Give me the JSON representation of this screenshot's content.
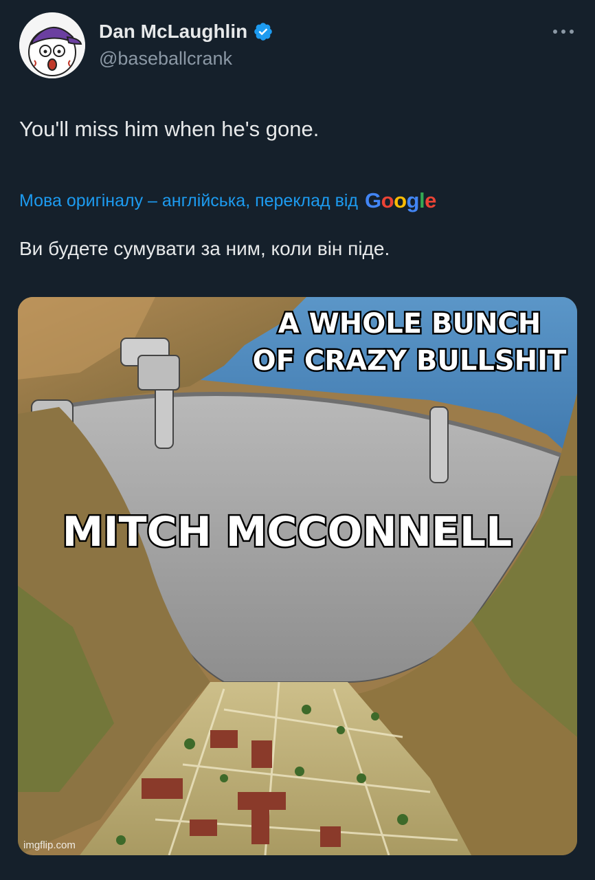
{
  "author": {
    "name": "Dan McLaughlin",
    "handle": "@baseballcrank",
    "verified": true,
    "avatar_icon": "baseball-cartoon-avatar"
  },
  "tweet": {
    "text": "You'll miss him when he's gone.",
    "translation_notice": "Мова оригіналу – англійська, переклад від",
    "translation_provider": "Google",
    "translated_text": "Ви будете сумувати за ним, коли він піде."
  },
  "media": {
    "top_caption_line1": "A WHOLE BUNCH",
    "top_caption_line2": "OF CRAZY BULLSHIT",
    "center_caption": "MITCH MCCONNELL",
    "watermark": "imgflip.com"
  },
  "colors": {
    "background": "#15202b",
    "link": "#1d9bf0",
    "secondary_text": "#8b98a5",
    "verified": "#1d9bf0"
  }
}
